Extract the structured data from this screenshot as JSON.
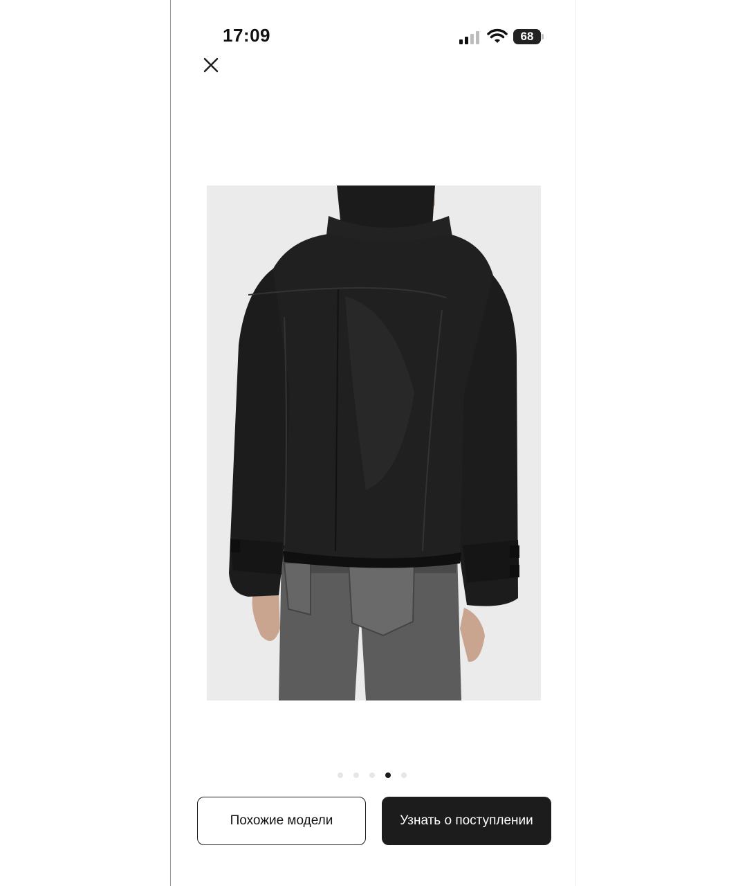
{
  "status_bar": {
    "time": "17:09",
    "battery": "68",
    "icons": [
      "cellular-signal-icon",
      "wifi-icon",
      "battery-icon"
    ]
  },
  "header": {
    "close_icon": "close-icon"
  },
  "gallery": {
    "image_subject": "product-photo",
    "page_count": 5,
    "active_index": 3
  },
  "actions": {
    "similar_label": "Похожие модели",
    "notify_label": "Узнать о поступлении"
  },
  "colors": {
    "primary_button_bg": "#1c1c1c",
    "photo_bg": "#ebebeb"
  }
}
